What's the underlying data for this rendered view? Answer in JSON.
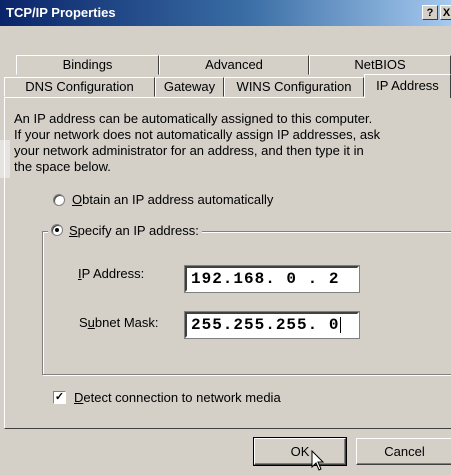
{
  "window": {
    "title": "TCP/IP Properties",
    "help_glyph": "?",
    "close_glyph": "X"
  },
  "tabs_back": [
    {
      "label": "Bindings"
    },
    {
      "label": "Advanced"
    },
    {
      "label": "NetBIOS"
    }
  ],
  "tabs_front": [
    {
      "label": "DNS Configuration"
    },
    {
      "label": "Gateway"
    },
    {
      "label": "WINS Configuration"
    },
    {
      "label": "IP Address",
      "active": true
    }
  ],
  "description": [
    "An IP address can be automatically assigned to this computer.",
    "If your network does not automatically assign IP addresses, ask",
    "your network administrator for an address, and then type it in",
    "the space below."
  ],
  "radio_auto": {
    "accel": "O",
    "rest": "btain an IP address automatically",
    "selected": false
  },
  "radio_specify": {
    "accel": "S",
    "rest": "pecify an IP address:",
    "selected": true
  },
  "ip_address": {
    "label_accel": "I",
    "label_rest": "P Address:",
    "value": "192.168. 0 . 2"
  },
  "subnet_mask": {
    "label_pre": "S",
    "label_accel": "u",
    "label_rest": "bnet Mask:",
    "value": "255.255.255. 0"
  },
  "detect": {
    "accel": "D",
    "rest": "etect connection to network media",
    "checked": true,
    "check_glyph": "✓"
  },
  "buttons": {
    "ok": "OK",
    "cancel": "Cancel"
  }
}
